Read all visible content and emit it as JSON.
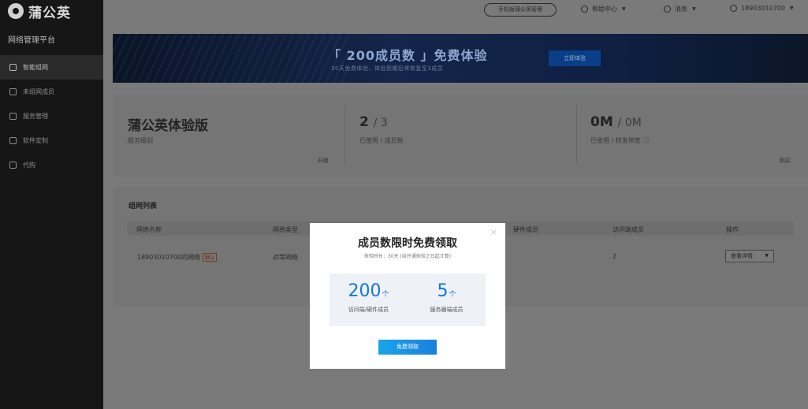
{
  "sidebar": {
    "logo": "蒲公英",
    "platform": "网络管理平台",
    "items": [
      {
        "label": "智能组网",
        "icon": "network-icon"
      },
      {
        "label": "未组网成员",
        "icon": "user-icon"
      },
      {
        "label": "服务管理",
        "icon": "list-icon"
      },
      {
        "label": "软件定制",
        "icon": "grid-icon"
      },
      {
        "label": "代购",
        "icon": "cart-icon"
      }
    ]
  },
  "topbar": {
    "phone_btn": "手机版蒲公英管理",
    "help": "帮助中心",
    "messages": "消息",
    "account": "18903010700"
  },
  "banner": {
    "title": "「 200成员数 」免费体验",
    "subtitle": "30天免费体验，体验到期后将恢复至3成员",
    "button": "立即体验"
  },
  "stats": {
    "service": {
      "value": "蒲公英体验版",
      "label": "服务级别",
      "link": "升级"
    },
    "members": {
      "used": "2",
      "total": "/ 3",
      "label": "已使用 / 成员数"
    },
    "bandwidth": {
      "used": "0M",
      "total": "/ 0M",
      "label": "已使用 / 转发带宽",
      "link": "购买"
    }
  },
  "list": {
    "title": "组网列表",
    "headers": [
      "网络名称",
      "网络类型",
      "硬件成员",
      "访问端成员",
      "操作"
    ],
    "row": {
      "name": "18903010700的网络",
      "tag": "默认",
      "type": "对等网络",
      "visitors": "2",
      "action": "查看详情"
    }
  },
  "modal": {
    "title": "成员数限时免费领取",
    "subtitle": "体验时长：30天 (自开通体验之日起计算)",
    "left": {
      "num": "200",
      "unit": "个",
      "label": "访问端/硬件成员"
    },
    "right": {
      "num": "5",
      "unit": "个",
      "label": "服务器端成员"
    },
    "button": "免费领取"
  }
}
